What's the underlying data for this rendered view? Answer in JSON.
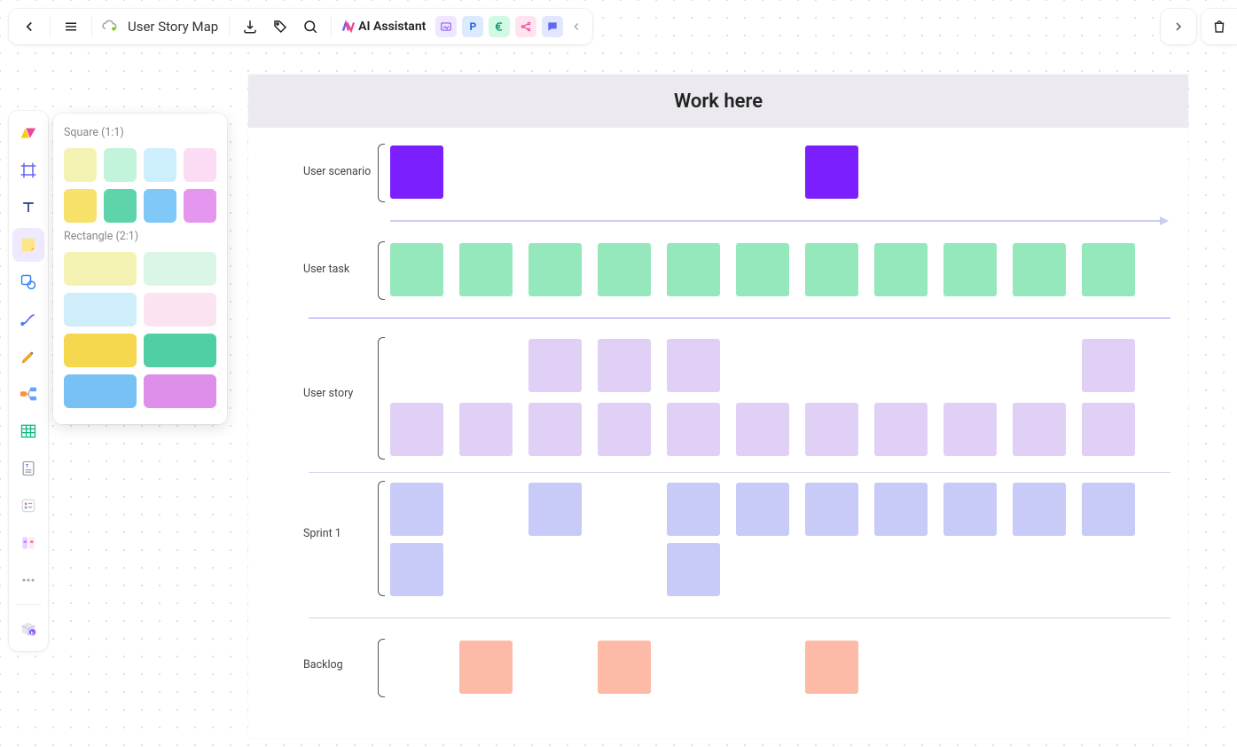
{
  "topbar": {
    "title": "User Story Map",
    "ai_label": "AI Assistant"
  },
  "palette": {
    "square_label": "Square (1:1)",
    "rectangle_label": "Rectangle (2:1)",
    "square_colors": [
      "#f3f2b2",
      "#c2f3db",
      "#cdeefc",
      "#fbdcf4",
      "#f7e16a",
      "#5fd4aa",
      "#7fc8f8",
      "#e597ef"
    ],
    "rect_colors": [
      "#f3f2b2",
      "#d9f6e6",
      "#d0edfb",
      "#fbe3f2",
      "#f6d84e",
      "#4fcfa3",
      "#78c1f5",
      "#dd8fe9"
    ]
  },
  "board": {
    "title": "Work here",
    "rows": {
      "scenario": {
        "label": "User scenario",
        "cols": [
          1,
          0,
          0,
          0,
          0,
          0,
          1,
          0,
          0,
          0,
          0
        ]
      },
      "task": {
        "label": "User task",
        "cols": [
          1,
          1,
          1,
          1,
          1,
          1,
          1,
          1,
          1,
          1,
          1
        ]
      },
      "story": {
        "label": "User story",
        "row1": [
          0,
          0,
          1,
          1,
          1,
          0,
          0,
          0,
          0,
          0,
          1
        ],
        "row2": [
          1,
          1,
          1,
          1,
          1,
          1,
          1,
          1,
          1,
          1,
          1
        ]
      },
      "sprint": {
        "label": "Sprint 1",
        "row1": [
          1,
          0,
          1,
          0,
          1,
          1,
          1,
          1,
          1,
          1,
          1
        ],
        "row2": [
          1,
          0,
          0,
          0,
          1,
          0,
          0,
          0,
          0,
          0,
          0
        ]
      },
      "backlog": {
        "label": "Backlog",
        "cols": [
          0,
          1,
          0,
          1,
          0,
          0,
          1,
          0,
          0,
          0,
          0
        ]
      }
    }
  }
}
